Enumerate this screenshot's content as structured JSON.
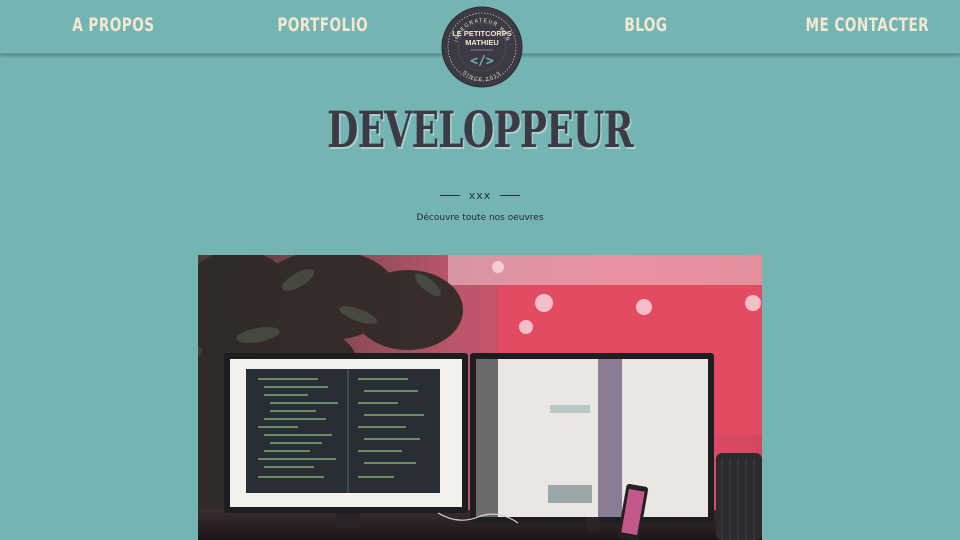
{
  "nav": {
    "items": [
      {
        "label": "A PROPOS"
      },
      {
        "label": "PORTFOLIO"
      },
      {
        "label": "BLOG"
      },
      {
        "label": "ME CONTACTER"
      }
    ]
  },
  "badge": {
    "arc_top": "INTEGRATEUR WEB",
    "name_line1": "LE PETITCORPS",
    "name_line2": "MATHIEU",
    "code_symbol": "</>",
    "arc_bottom": "SINCE 2013"
  },
  "hero": {
    "title": "DEVELOPPEUR",
    "divider_text": "xxx",
    "subtitle": "Découvre toute nos oeuvres"
  },
  "colors": {
    "background": "#74b4b3",
    "nav_text": "#f2e7cf",
    "badge_fill": "#3c3b45",
    "title": "#3c3b45"
  },
  "icons": {
    "badge_code": "code-brackets-icon"
  }
}
